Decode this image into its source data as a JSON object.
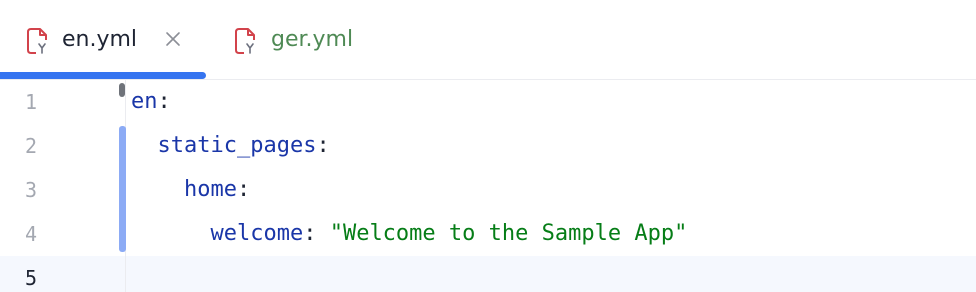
{
  "tabs": [
    {
      "label": "en.yml",
      "active": true,
      "closable": true,
      "icon": "yaml-file-icon"
    },
    {
      "label": "ger.yml",
      "active": false,
      "closable": false,
      "icon": "yaml-file-icon"
    }
  ],
  "editor": {
    "line_numbers": [
      "1",
      "2",
      "3",
      "4",
      "5"
    ],
    "current_line": "5",
    "lines": [
      {
        "indent": "",
        "key": "en",
        "colon": ":",
        "value": ""
      },
      {
        "indent": "  ",
        "key": "static_pages",
        "colon": ":",
        "value": ""
      },
      {
        "indent": "    ",
        "key": "home",
        "colon": ":",
        "value": ""
      },
      {
        "indent": "      ",
        "key": "welcome",
        "colon": ": ",
        "value": "\"Welcome to the Sample App\""
      },
      {
        "indent": "",
        "key": "",
        "colon": "",
        "value": ""
      }
    ]
  },
  "colors": {
    "accent": "#3574f0",
    "yaml_key": "#1a36a8",
    "yaml_string": "#067d17",
    "inactive_tab_text": "#4f8a55",
    "yaml_icon": "#d2434b"
  }
}
